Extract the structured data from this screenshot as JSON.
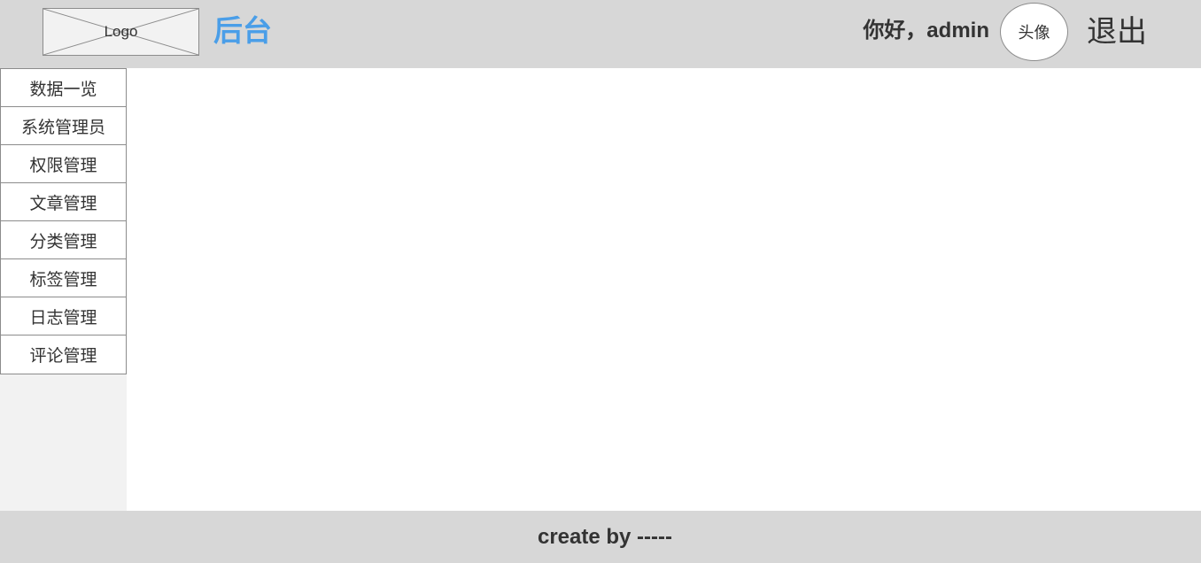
{
  "header": {
    "logo_text": "Logo",
    "title": "后台",
    "greeting": "你好，admin",
    "avatar_text": "头像",
    "logout_label": "退出"
  },
  "sidebar": {
    "items": [
      {
        "label": "数据一览"
      },
      {
        "label": "系统管理员"
      },
      {
        "label": "权限管理"
      },
      {
        "label": "文章管理"
      },
      {
        "label": "分类管理"
      },
      {
        "label": "标签管理"
      },
      {
        "label": "日志管理"
      },
      {
        "label": "评论管理"
      }
    ]
  },
  "footer": {
    "text": "create by -----"
  },
  "colors": {
    "header_bg": "#d7d7d7",
    "title_accent": "#4a9ee8",
    "sidebar_bg": "#f2f2f2"
  }
}
